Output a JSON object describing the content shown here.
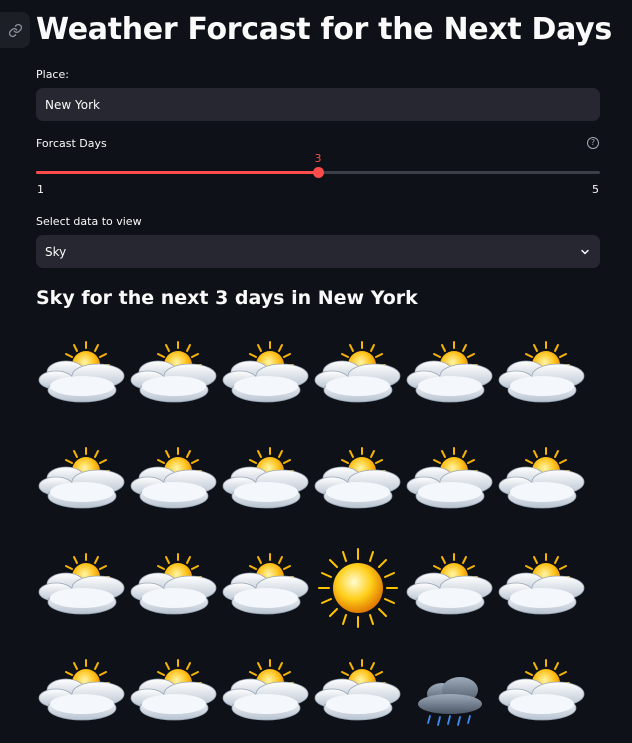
{
  "page": {
    "title": "Weather Forcast for the Next Days"
  },
  "place": {
    "label": "Place:",
    "value": "New York"
  },
  "forecast_days": {
    "label": "Forcast Days",
    "help_icon": "?",
    "value": "3",
    "min": "1",
    "max": "5",
    "fill_fraction": 0.5
  },
  "data_select": {
    "label": "Select data to view",
    "selected": "Sky"
  },
  "results": {
    "heading": "Sky for the next 3 days in New York",
    "images": [
      "partly-cloudy",
      "partly-cloudy",
      "partly-cloudy",
      "partly-cloudy",
      "partly-cloudy",
      "partly-cloudy",
      "partly-cloudy",
      "partly-cloudy",
      "partly-cloudy",
      "partly-cloudy",
      "partly-cloudy",
      "partly-cloudy",
      "partly-cloudy",
      "partly-cloudy",
      "partly-cloudy",
      "sun",
      "partly-cloudy",
      "partly-cloudy",
      "partly-cloudy",
      "partly-cloudy",
      "partly-cloudy",
      "partly-cloudy",
      "rain",
      "partly-cloudy"
    ]
  },
  "colors": {
    "background": "#0e1117",
    "accent": "#ff4b4b",
    "input_bg": "#262730"
  }
}
